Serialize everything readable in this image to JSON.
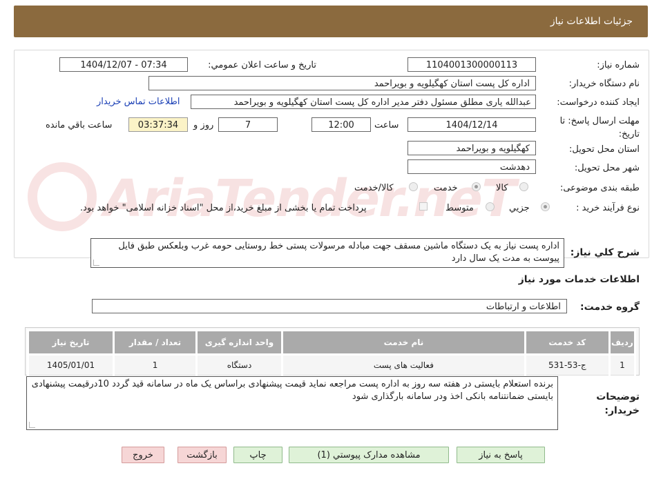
{
  "header": {
    "title": "جزئیات اطلاعات نیاز"
  },
  "fields": {
    "need_number_label": "شماره نیاز:",
    "need_number": "1104001300000113",
    "announce_label": "تاریخ و ساعت اعلان عمومي:",
    "announce_value": "1404/12/07 - 07:34",
    "buyer_label": "نام دستگاه خریدار:",
    "buyer_value": "اداره کل پست استان کهگیلویه و بویراحمد",
    "creator_label": "ایجاد کننده درخواست:",
    "creator_value": "عبدالله یاری مطلق مسئول دفتر مدیر اداره کل پست استان کهگیلویه و بویراحمد",
    "contact_link": "اطلاعات تماس خریدار",
    "deadline_label": "مهلت ارسال پاسخ: تا تاریخ:",
    "deadline_date": "1404/12/14",
    "time_label": "ساعت",
    "deadline_time": "12:00",
    "days_value": "7",
    "days_label": "روز و",
    "remaining_time": "03:37:34",
    "remaining_label": "ساعت باقي مانده",
    "province_label": "استان محل تحویل:",
    "province_value": "کهگیلویه و بویراحمد",
    "city_label": "شهر محل تحویل:",
    "city_value": "دهدشت",
    "category_label": "طبقه بندی موضوعی:",
    "category_options": [
      "کالا",
      "خدمت",
      "کالا/خدمت"
    ],
    "category_selected": "خدمت",
    "process_label": "نوع فرآیند خرید :",
    "process_options": [
      "جزیي",
      "متوسط"
    ],
    "process_selected": "جزیي",
    "payment_note": "پرداخت تمام یا بخشی از مبلغ خرید،از محل \"اسناد خزانه اسلامی\" خواهد بود."
  },
  "description": {
    "label": "شرح کلي نیاز:",
    "text": "اداره پست نیاز به یک دستگاه ماشین مسقف جهت مبادله مرسولات پستی خط روستایی حومه غرب وبلعکس طبق فایل پیوست به مدت یک سال دارد"
  },
  "services": {
    "section_title": "اطلاعات خدمات مورد نیاز",
    "group_label": "گروه خدمت:",
    "group_value": "اطلاعات و ارتباطات",
    "columns": [
      "ردیف",
      "کد خدمت",
      "نام خدمت",
      "واحد اندازه گیری",
      "تعداد / مقدار",
      "تاریخ نیاز"
    ],
    "rows": [
      [
        "1",
        "ج-53-531",
        "فعالیت های پست",
        "دستگاه",
        "1",
        "1405/01/01"
      ]
    ]
  },
  "buyer_notes": {
    "label": "توضیحات خریدار:",
    "text": "برنده استعلام بایستی  در هفته سه  روز به اداره  پست مراجعه نماید  قیمت پیشنهادی براساس یک ماه در سامانه قید گردد 10درقیمت پیشنهادی  بایستی ضمانتنامه بانکی اخذ ودر سامانه بارگذاری شود"
  },
  "buttons": {
    "reply": "پاسخ به نیاز",
    "attachments": "مشاهده مدارک پیوستي (1)",
    "print": "چاپ",
    "back": "بازگشت",
    "exit": "خروج"
  },
  "colors": {
    "header": "#8b6a3e",
    "timer_bg": "#fbf3c7",
    "green_btn": "#dff2d8",
    "pink_btn": "#f6d6d6",
    "link": "#1a3fb5"
  }
}
